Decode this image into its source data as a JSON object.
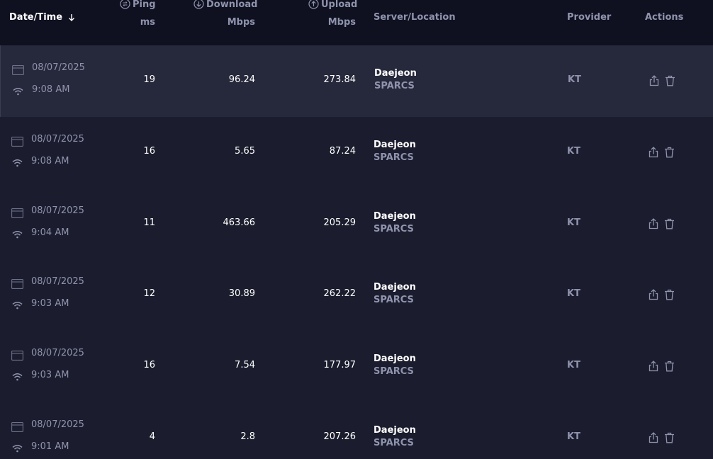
{
  "header": {
    "datetime_label": "Date/Time",
    "ping_label": "Ping",
    "ping_unit": "ms",
    "download_label": "Download",
    "download_unit": "Mbps",
    "upload_label": "Upload",
    "upload_unit": "Mbps",
    "server_label": "Server/Location",
    "provider_label": "Provider",
    "actions_label": "Actions"
  },
  "rows": [
    {
      "date": "08/07/2025",
      "time": "9:08 AM",
      "ping": "19",
      "download": "96.24",
      "upload": "273.84",
      "server": "Daejeon",
      "location": "SPARCS",
      "provider": "KT"
    },
    {
      "date": "08/07/2025",
      "time": "9:08 AM",
      "ping": "16",
      "download": "5.65",
      "upload": "87.24",
      "server": "Daejeon",
      "location": "SPARCS",
      "provider": "KT"
    },
    {
      "date": "08/07/2025",
      "time": "9:04 AM",
      "ping": "11",
      "download": "463.66",
      "upload": "205.29",
      "server": "Daejeon",
      "location": "SPARCS",
      "provider": "KT"
    },
    {
      "date": "08/07/2025",
      "time": "9:03 AM",
      "ping": "12",
      "download": "30.89",
      "upload": "262.22",
      "server": "Daejeon",
      "location": "SPARCS",
      "provider": "KT"
    },
    {
      "date": "08/07/2025",
      "time": "9:03 AM",
      "ping": "16",
      "download": "7.54",
      "upload": "177.97",
      "server": "Daejeon",
      "location": "SPARCS",
      "provider": "KT"
    },
    {
      "date": "08/07/2025",
      "time": "9:01 AM",
      "ping": "4",
      "download": "2.8",
      "upload": "207.26",
      "server": "Daejeon",
      "location": "SPARCS",
      "provider": "KT"
    }
  ],
  "colors": {
    "background": "#1b1d2e",
    "header_background": "#0f1120",
    "highlight_row": "#26283b",
    "muted_text": "#8f93ad"
  }
}
